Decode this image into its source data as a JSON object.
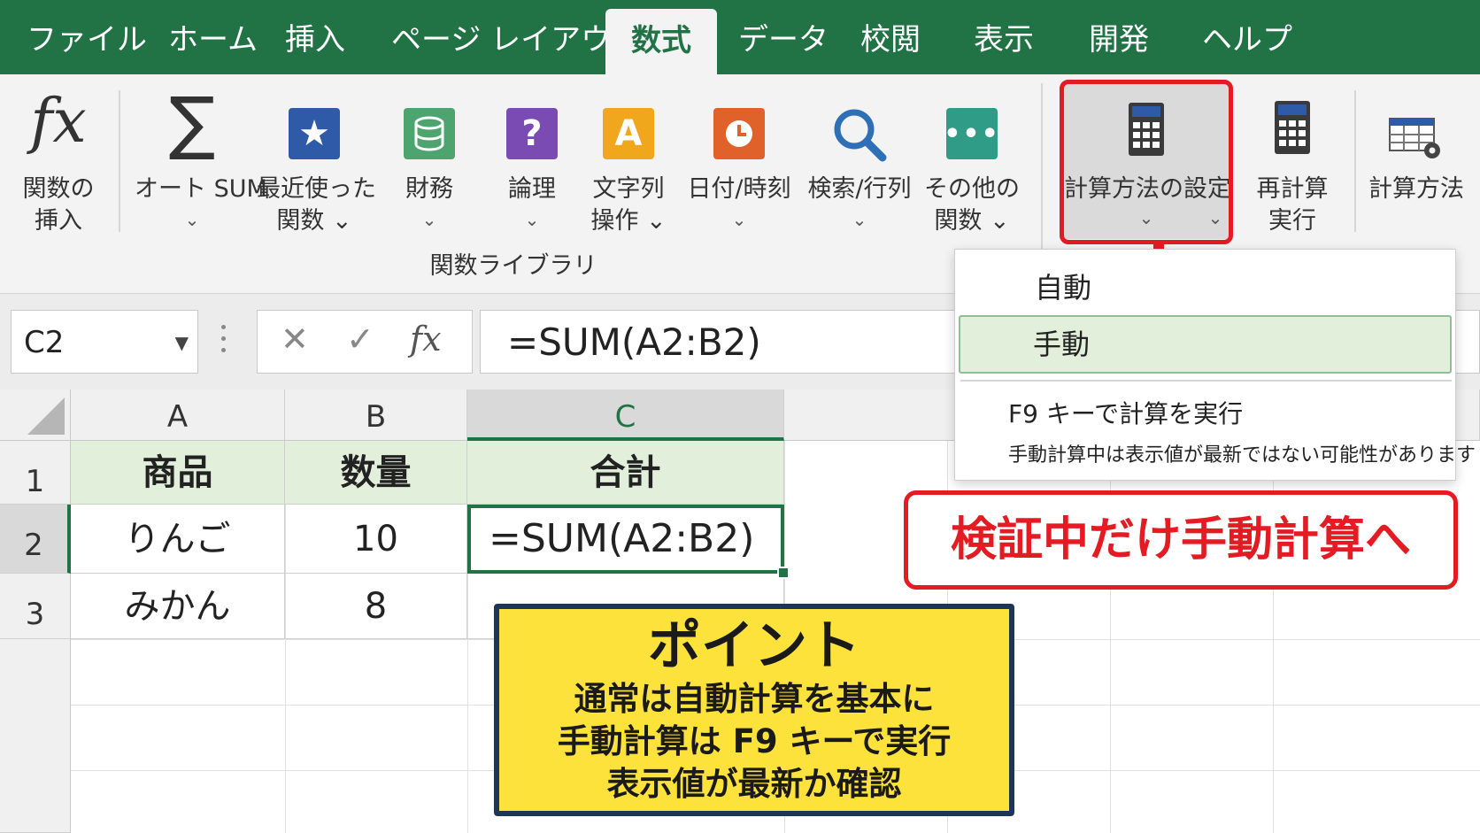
{
  "tabs": [
    "ファイル",
    "ホーム",
    "挿入",
    "ページ レイアウト",
    "数式",
    "データ",
    "校閲",
    "表示",
    "開発",
    "ヘルプ"
  ],
  "active_tab": "数式",
  "ribbon": {
    "insert_function": {
      "line1": "関数の",
      "line2": "挿入",
      "icon": "fx-icon"
    },
    "autosum": {
      "label": "オート SUM",
      "icon": "sigma-icon"
    },
    "recent": {
      "line1": "最近使った",
      "line2": "関数",
      "icon": "star-icon"
    },
    "financial": {
      "label": "財務",
      "icon": "coins-icon"
    },
    "logical": {
      "label": "論理",
      "icon": "question-icon"
    },
    "text": {
      "line1": "文字列",
      "line2": "操作",
      "icon": "letter-a-icon"
    },
    "datetime": {
      "label": "日付/時刻",
      "icon": "clock-icon"
    },
    "lookup": {
      "label": "検索/行列",
      "icon": "magnifier-icon"
    },
    "more": {
      "line1": "その他の",
      "line2": "関数",
      "icon": "more-icon"
    },
    "group_label": "関数ライブラリ",
    "calc_options": {
      "label": "計算方法の設定",
      "icon": "calculator-icon"
    },
    "calc_now": {
      "line1": "再計算",
      "line2": "実行",
      "icon": "calculator-icon"
    },
    "calc_method": {
      "label": "計算方法",
      "icon": "table-gear-icon"
    }
  },
  "formula_bar": {
    "name_box": "C2",
    "cancel": "✕",
    "enter": "✓",
    "fx": "fx",
    "formula": "=SUM(A2:B2)"
  },
  "sheet": {
    "columns": [
      "A",
      "B",
      "C"
    ],
    "rows": [
      "1",
      "2",
      "3"
    ],
    "cells": {
      "A1": "商品",
      "B1": "数量",
      "C1": "合計",
      "A2": "りんご",
      "B2": "10",
      "C2": "=SUM(A2:B2)",
      "A3": "みかん",
      "B3": "8"
    },
    "active_cell": "C2"
  },
  "menu": {
    "auto": "自動",
    "manual": "手動",
    "f9": "F9 キーで計算を実行",
    "note": "手動計算中は表示値が最新ではない可能性があります"
  },
  "callout": "検証中だけ手動計算へ",
  "point": {
    "title": "ポイント",
    "lines": [
      "通常は自動計算を基本に",
      "手動計算は F9 キーで実行",
      "表示値が最新か確認"
    ]
  },
  "colors": {
    "excel_green": "#217346",
    "highlight_red": "#e41b23",
    "point_yellow": "#fde23c",
    "header_fill": "#e2efda"
  }
}
